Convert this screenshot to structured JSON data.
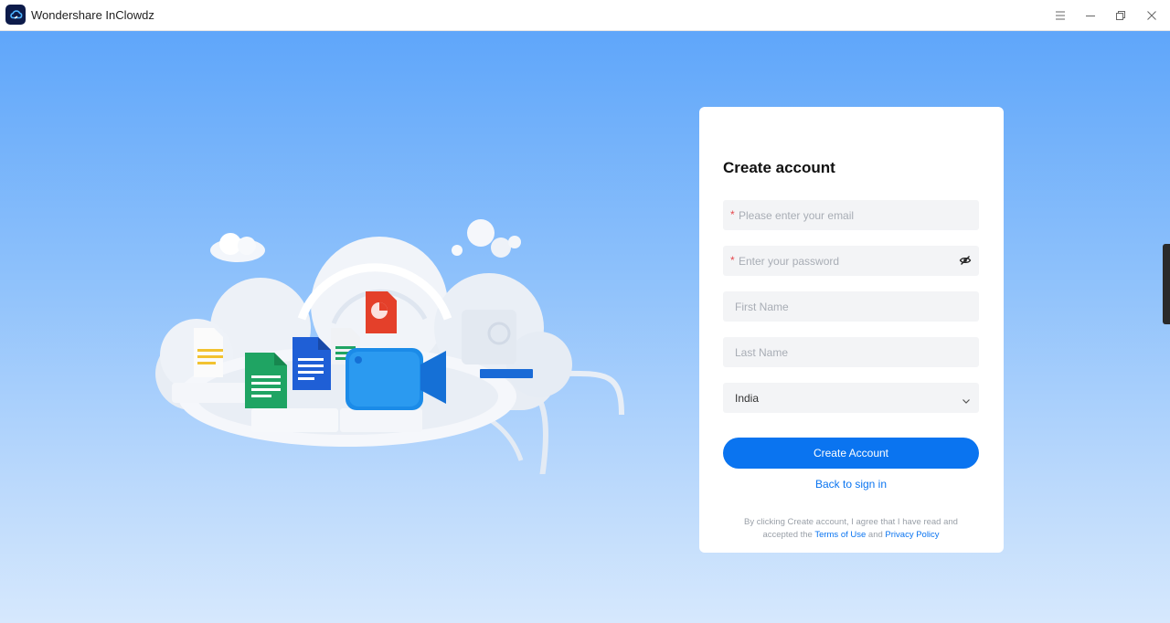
{
  "window": {
    "title": "Wondershare InClowdz"
  },
  "form": {
    "title": "Create account",
    "email_placeholder": "Please enter your email",
    "password_placeholder": "Enter your password",
    "first_name_placeholder": "First Name",
    "last_name_placeholder": "Last Name",
    "country_value": "India",
    "required_mark": "*",
    "submit_label": "Create Account",
    "back_link": "Back to sign in",
    "legal": {
      "line1": "By clicking Create account, I agree that I have read and",
      "line2_prefix": "accepted the",
      "terms_link": "Terms of Use",
      "and_text": "and",
      "privacy_link": "Privacy Policy"
    }
  },
  "icons": {
    "app": "inclowdz-logo-icon",
    "menu": "hamburger-menu-icon",
    "minimize": "minimize-icon",
    "restore": "restore-icon",
    "close": "close-icon",
    "password_toggle": "eye-hidden-icon",
    "dropdown": "chevron-down-icon"
  },
  "colors": {
    "accent": "#0a74f0",
    "background_top": "#5fa6fa",
    "background_bottom": "#d6e8fd",
    "required": "#e5484d"
  }
}
